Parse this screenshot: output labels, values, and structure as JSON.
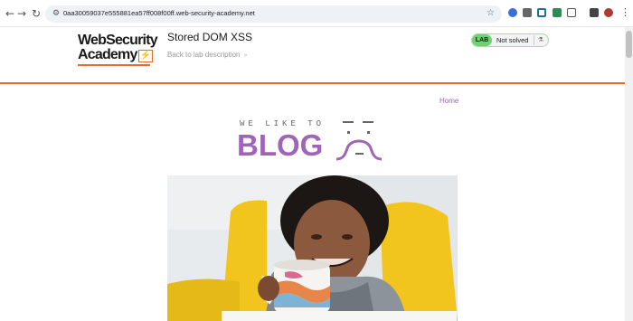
{
  "browser": {
    "url": "0aa30059037e555881ea57ff008f00ff.web-security-academy.net",
    "icons": [
      "back-arrow-icon",
      "forward-arrow-icon",
      "reload-icon",
      "tune-icon",
      "bookmark-star-icon",
      "extension-icons",
      "profile-avatar",
      "menu-kebab-icon"
    ]
  },
  "lab_header": {
    "logo_line1": "WebSecurity",
    "logo_line2": "Academy",
    "logo_bolt": "⚡",
    "title": "Stored DOM XSS",
    "back_link": "Back to lab description",
    "back_chevron": "»",
    "status_badge": "LAB",
    "status_text": "Not solved",
    "colors": {
      "accent": "#e8692b",
      "status_green": "#70d16d"
    }
  },
  "site_nav": {
    "home": "Home"
  },
  "banner": {
    "small_text": "WE LIKE TO",
    "big_text": "BLOG",
    "color": "#a065b8"
  },
  "hero_image": {
    "alt": "Woman smiling holding a patterned mug"
  }
}
